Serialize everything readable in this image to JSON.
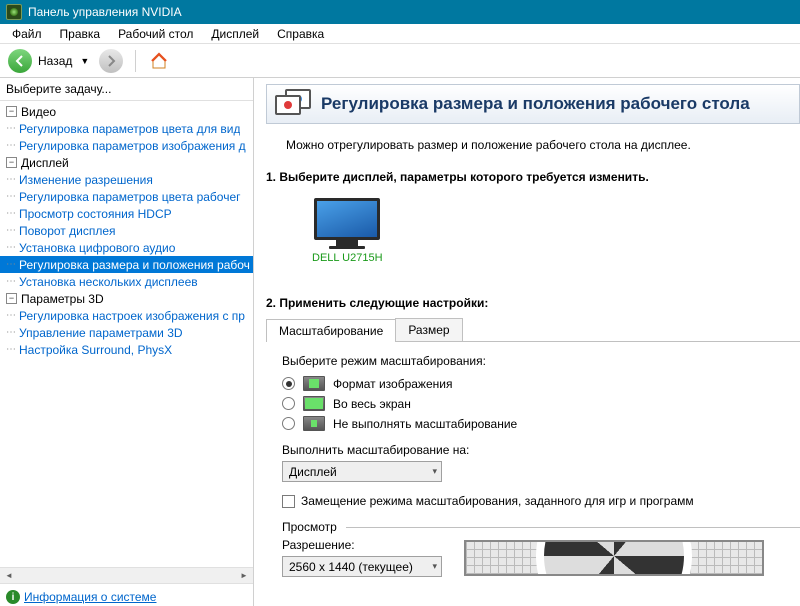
{
  "window": {
    "title": "Панель управления NVIDIA"
  },
  "menu": {
    "file": "Файл",
    "edit": "Правка",
    "desktop": "Рабочий стол",
    "display": "Дисплей",
    "help": "Справка"
  },
  "toolbar": {
    "back": "Назад"
  },
  "sidebar": {
    "header": "Выберите задачу...",
    "tree": {
      "video": {
        "label": "Видео",
        "items": [
          "Регулировка параметров цвета для вид",
          "Регулировка параметров изображения д"
        ]
      },
      "display": {
        "label": "Дисплей",
        "items": [
          "Изменение разрешения",
          "Регулировка параметров цвета рабочег",
          "Просмотр состояния HDCP",
          "Поворот дисплея",
          "Установка цифрового аудио",
          "Регулировка размера и положения рабоч",
          "Установка нескольких дисплеев"
        ]
      },
      "params3d": {
        "label": "Параметры 3D",
        "items": [
          "Регулировка настроек изображения с пр",
          "Управление параметрами 3D",
          "Настройка Surround, PhysX"
        ]
      }
    },
    "footer": "Информация о системе"
  },
  "page": {
    "title": "Регулировка размера и положения рабочего стола",
    "intro": "Можно отрегулировать размер и положение рабочего стола на дисплее.",
    "step1": {
      "title": "1. Выберите дисплей, параметры которого требуется изменить.",
      "display_name": "DELL U2715H"
    },
    "step2": {
      "title": "2. Применить следующие настройки:",
      "tabs": {
        "scaling": "Масштабирование",
        "size": "Размер"
      },
      "mode_label": "Выберите режим масштабирования:",
      "modes": {
        "aspect": "Формат изображения",
        "full": "Во весь экран",
        "none": "Не выполнять масштабирование"
      },
      "perform_on_label": "Выполнить масштабирование на:",
      "perform_on_value": "Дисплей",
      "override": "Замещение режима масштабирования, заданного для игр и программ",
      "preview": "Просмотр",
      "resolution_label": "Разрешение:",
      "resolution_value": "2560 x 1440 (текущее)"
    }
  }
}
